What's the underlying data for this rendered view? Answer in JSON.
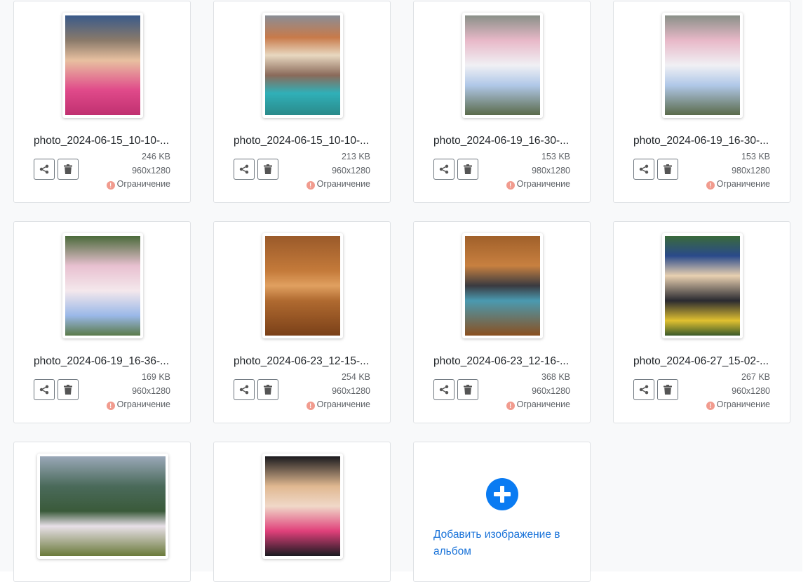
{
  "photos": [
    {
      "name": "photo_2024-06-15_10-10-...",
      "size": "246 KB",
      "dims": "960x1280",
      "status": "Ограничение"
    },
    {
      "name": "photo_2024-06-15_10-10-...",
      "size": "213 KB",
      "dims": "960x1280",
      "status": "Ограничение"
    },
    {
      "name": "photo_2024-06-19_16-30-...",
      "size": "153 KB",
      "dims": "980x1280",
      "status": "Ограничение"
    },
    {
      "name": "photo_2024-06-19_16-30-...",
      "size": "153 KB",
      "dims": "980x1280",
      "status": "Ограничение"
    },
    {
      "name": "photo_2024-06-19_16-36-...",
      "size": "169 KB",
      "dims": "960x1280",
      "status": "Ограничение"
    },
    {
      "name": "photo_2024-06-23_12-15-...",
      "size": "254 KB",
      "dims": "960x1280",
      "status": "Ограничение"
    },
    {
      "name": "photo_2024-06-23_12-16-...",
      "size": "368 KB",
      "dims": "960x1280",
      "status": "Ограничение"
    },
    {
      "name": "photo_2024-06-27_15-02-...",
      "size": "267 KB",
      "dims": "960x1280",
      "status": "Ограничение"
    },
    {
      "name": "",
      "size": "",
      "dims": "",
      "status": ""
    },
    {
      "name": "",
      "size": "",
      "dims": "",
      "status": ""
    }
  ],
  "add_image": {
    "label": "Добавить изображение в альбом"
  },
  "status_icon": "exclamation-circle-icon",
  "colors": {
    "accent": "#0a7bf2",
    "warning": "#f19b8e",
    "link": "#1a73d9"
  }
}
